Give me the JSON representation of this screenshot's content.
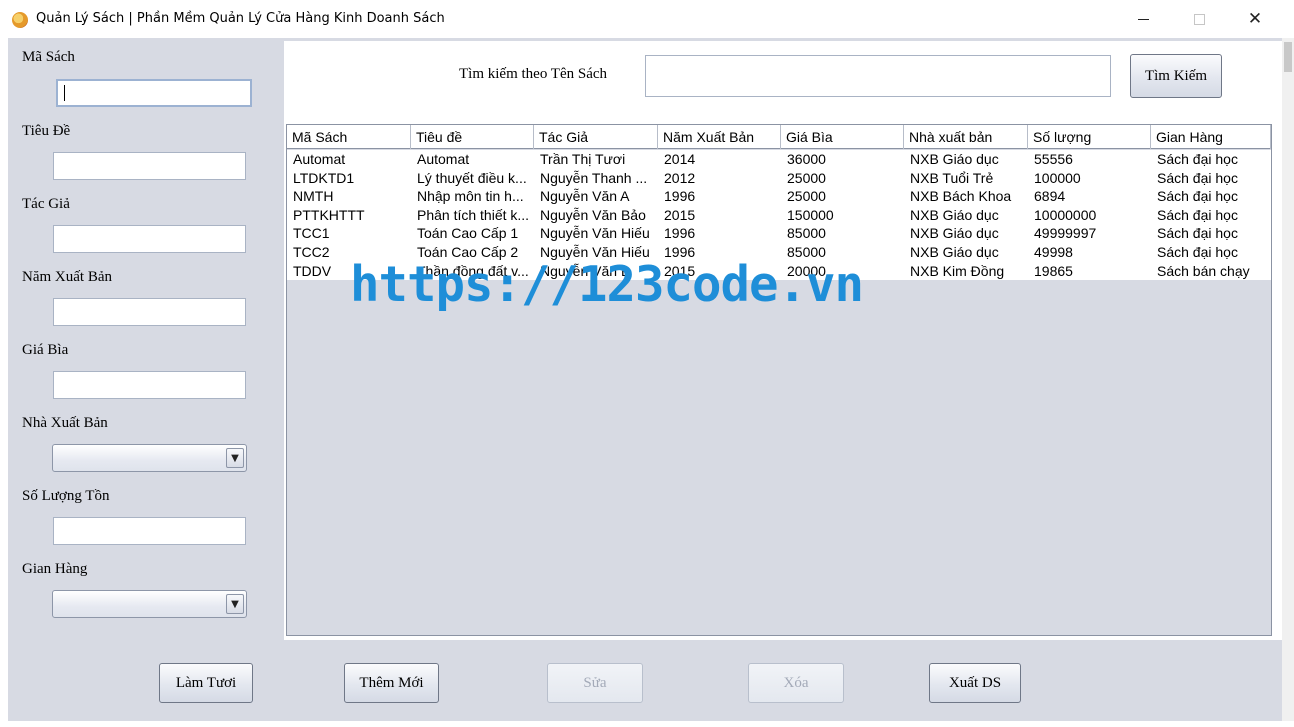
{
  "window": {
    "title": "Quản Lý Sách | Phần Mềm Quản Lý Cửa Hàng Kinh Doanh Sách",
    "minimize": "–",
    "maximize": "☐",
    "close": "✕"
  },
  "form": {
    "ma_sach_label": "Mã Sách",
    "tieu_de_label": "Tiêu Đề",
    "tac_gia_label": "Tác Giả",
    "nam_xuat_ban_label": "Năm Xuất Bản",
    "gia_bia_label": "Giá Bìa",
    "nha_xuat_ban_label": "Nhà Xuất Bản",
    "so_luong_ton_label": "Số Lượng Tồn",
    "gian_hang_label": "Gian Hàng",
    "ma_sach_value": "",
    "tieu_de_value": "",
    "tac_gia_value": "",
    "nam_xuat_ban_value": "",
    "gia_bia_value": "",
    "nha_xuat_ban_value": "",
    "so_luong_ton_value": "",
    "gian_hang_value": ""
  },
  "search": {
    "label": "Tìm kiếm theo Tên Sách",
    "value": "",
    "button": "Tìm Kiếm"
  },
  "table": {
    "headers": [
      "Mã Sách",
      "Tiêu đề",
      "Tác Giả",
      "Năm Xuất Bản",
      "Giá Bìa",
      "Nhà xuất bản",
      "Số lượng",
      "Gian Hàng"
    ],
    "rows": [
      [
        "Automat",
        "Automat",
        "Trần Thị Tươi",
        "2014",
        "36000",
        "NXB Giáo dục",
        "55556",
        "Sách đại học"
      ],
      [
        "LTDKTD1",
        "Lý thuyết điều k...",
        "Nguyễn Thanh ...",
        "2012",
        "25000",
        "NXB Tuổi Trẻ",
        "100000",
        "Sách đại học"
      ],
      [
        "NMTH",
        "Nhập môn tin h...",
        "Nguyễn Văn A",
        "1996",
        "25000",
        "NXB Bách Khoa",
        "6894",
        "Sách đại học"
      ],
      [
        "PTTKHTTT",
        "Phân tích thiết k...",
        "Nguyễn Văn Bảo",
        "2015",
        "150000",
        "NXB Giáo dục",
        "10000000",
        "Sách đại học"
      ],
      [
        "TCC1",
        "Toán Cao Cấp 1",
        "Nguyễn Văn Hiếu",
        "1996",
        "85000",
        "NXB Giáo dục",
        "49999997",
        "Sách đại học"
      ],
      [
        "TCC2",
        "Toán Cao Cấp 2",
        "Nguyễn Văn Hiếu",
        "1996",
        "85000",
        "NXB Giáo dục",
        "49998",
        "Sách đại học"
      ],
      [
        "TDDV",
        "Thần đồng đất v...",
        "Nguyễn Văn B",
        "2015",
        "20000",
        "NXB Kim Đồng",
        "19865",
        "Sách bán chạy"
      ]
    ]
  },
  "watermark": "https://123code.vn",
  "buttons": {
    "refresh": "Làm Tươi",
    "add": "Thêm Mới",
    "edit": "Sửa",
    "delete": "Xóa",
    "export": "Xuất DS"
  },
  "icons": {
    "app": "book-stack-icon",
    "dropdown": "chevron-down-icon"
  },
  "colors": {
    "background": "#d7dae3",
    "watermark": "#1e8ed8"
  }
}
